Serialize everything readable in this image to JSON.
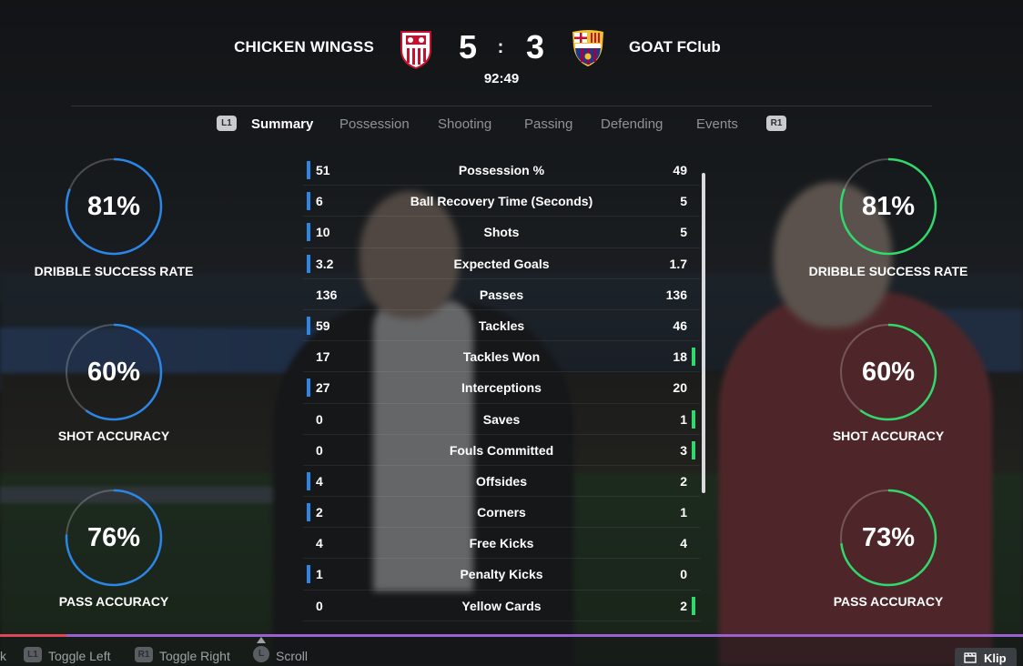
{
  "header": {
    "home_team": "CHICKEN WINGSS",
    "away_team": "GOAT FClub",
    "home_score": "5",
    "separator": ":",
    "away_score": "3",
    "clock": "92:49",
    "home_crest": "sevilla-crest-icon",
    "away_crest": "barcelona-crest-icon"
  },
  "tabs": {
    "left_bumper": "L1",
    "right_bumper": "R1",
    "items": [
      "Summary",
      "Possession",
      "Shooting",
      "Passing",
      "Defending",
      "Events"
    ],
    "active": "Summary"
  },
  "home_rings": [
    {
      "value": "81%",
      "fraction": 0.81,
      "label": "DRIBBLE SUCCESS RATE"
    },
    {
      "value": "60%",
      "fraction": 0.6,
      "label": "SHOT ACCURACY"
    },
    {
      "value": "76%",
      "fraction": 0.76,
      "label": "PASS ACCURACY"
    }
  ],
  "away_rings": [
    {
      "value": "81%",
      "fraction": 0.81,
      "label": "DRIBBLE SUCCESS RATE"
    },
    {
      "value": "60%",
      "fraction": 0.6,
      "label": "SHOT ACCURACY"
    },
    {
      "value": "73%",
      "fraction": 0.73,
      "label": "PASS ACCURACY"
    }
  ],
  "stats": [
    {
      "home": "51",
      "label": "Possession %",
      "away": "49"
    },
    {
      "home": "6",
      "label": "Ball Recovery Time (Seconds)",
      "away": "5"
    },
    {
      "home": "10",
      "label": "Shots",
      "away": "5"
    },
    {
      "home": "3.2",
      "label": "Expected Goals",
      "away": "1.7"
    },
    {
      "home": "136",
      "label": "Passes",
      "away": "136"
    },
    {
      "home": "59",
      "label": "Tackles",
      "away": "46"
    },
    {
      "home": "17",
      "label": "Tackles Won",
      "away": "18"
    },
    {
      "home": "27",
      "label": "Interceptions",
      "away": "20"
    },
    {
      "home": "0",
      "label": "Saves",
      "away": "1"
    },
    {
      "home": "0",
      "label": "Fouls Committed",
      "away": "3"
    },
    {
      "home": "4",
      "label": "Offsides",
      "away": "2"
    },
    {
      "home": "2",
      "label": "Corners",
      "away": "1"
    },
    {
      "home": "4",
      "label": "Free Kicks",
      "away": "4"
    },
    {
      "home": "1",
      "label": "Penalty Kicks",
      "away": "0"
    },
    {
      "home": "0",
      "label": "Yellow Cards",
      "away": "2"
    }
  ],
  "hints": {
    "cut_text": "k",
    "l1": "L1",
    "toggle_left": "Toggle Left",
    "r1": "R1",
    "toggle_right": "Toggle Right",
    "l_stick": "L",
    "scroll": "Scroll"
  },
  "klip": {
    "label": "Klip"
  },
  "colors": {
    "home_accent": "#2b86e6",
    "away_accent": "#31d86c",
    "progress": "#9a5fd0",
    "progress_played": "#e0465a"
  },
  "video_progress": 0.065
}
